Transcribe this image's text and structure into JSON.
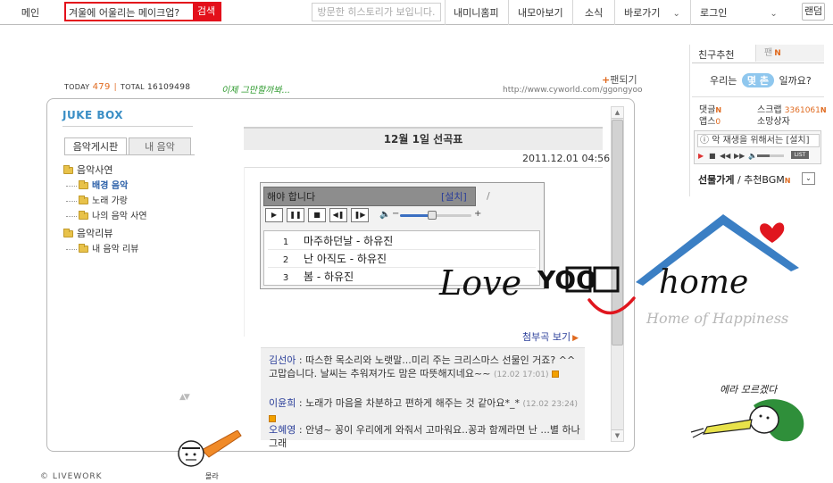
{
  "topbar": {
    "home_label": "메인",
    "search_value": "겨울에 어울리는 메이크업?",
    "search_button": "검색",
    "history_button": "방문한 히스토리가 보입니다.",
    "nav": {
      "mini_home": "내미니홈피",
      "my_collection": "내모아보기",
      "news": "소식",
      "shortcuts": "바로가기",
      "login": "로그인",
      "random": "랜덤"
    }
  },
  "counters": {
    "today_label": "TODAY",
    "today_value": "479",
    "total_label": "TOTAL",
    "total_value": "16109498",
    "green_note": "이제 그만할까봐...",
    "fan_link": "팬되기",
    "homepage_url": "http://www.cyworld.com/ggongyoo"
  },
  "jukebox": {
    "title": "JUKE BOX",
    "tabs": [
      "음악게시판",
      "내 음악"
    ],
    "tree": [
      {
        "label": "음악사연",
        "children": [
          "배경 음악",
          "노래 가랑",
          "나의 음악 사연"
        ]
      },
      {
        "label": "음악리뷰",
        "children": [
          "내 음악 리뷰"
        ]
      }
    ]
  },
  "post": {
    "title": "12월 1일 선곡표",
    "date": "2011.12.01 04:56",
    "attach_link": "첨부곡 보기"
  },
  "player": {
    "message": "해야 합니다",
    "install_link": "[설치]",
    "slash": "/",
    "volume": 0.45,
    "tracks": [
      {
        "num": "1",
        "title": "마주하던날 - 하유진"
      },
      {
        "num": "2",
        "title": "난 아직도 - 하유진"
      },
      {
        "num": "3",
        "title": "봄 - 하유진"
      }
    ]
  },
  "comments": [
    {
      "author": "김선아",
      "text": " : 따스한 목소리와 노랫말...미리 주는 크리스마스 선물인 거죠? ^^ 고맙습니다. 날씨는 추워져가도 맘은 따뜻해지네요~~",
      "time": "(12.02 17:01)"
    },
    {
      "author": "이윤희",
      "text": " : 노래가 마음을 차분하고 편하게 해주는 것 같아요*_* ",
      "time": "(12.02 23:24)"
    },
    {
      "author": "오혜영",
      "text": " : 안녕~ 꽁이 우리에게 와줘서 고마워요..꽁과 함께라면 난 ...별 하나 그래",
      "time": ""
    }
  ],
  "sidebar": {
    "friend_tab": "친구추천",
    "fan_tab": "팬",
    "new_badge": "N",
    "we_are_prefix": "우리는",
    "we_are_badge": "몇 촌",
    "we_are_suffix": "일까요?",
    "reply_label": "댓글",
    "scrap_label": "스크랩",
    "scrap_value": "3361061",
    "apps_label": "앱스",
    "apps_value": "0",
    "wish_label": "소망상자",
    "mini_player_msg": "악 재생을 위해서는 [설치]",
    "list_label": "LIST",
    "gift_label": "선물가게",
    "bgm_label": " / 추천BGM"
  },
  "logo": {
    "love": "Love",
    "yoo": "YOO",
    "home": "home",
    "tagline": "Home of Happiness"
  },
  "doodles": {
    "girl_text": "에라 모르겠다",
    "kid_text": "몰라"
  },
  "footer": {
    "copyright": "© LIVEWORK"
  },
  "colors": {
    "search_red": "#e3101b",
    "jukebox_blue": "#3a8ec5",
    "accent_orange": "#e06a1f",
    "link_blue": "#2b3f9a",
    "roof_blue": "#3b7fc4",
    "heart_red": "#e0161e"
  }
}
